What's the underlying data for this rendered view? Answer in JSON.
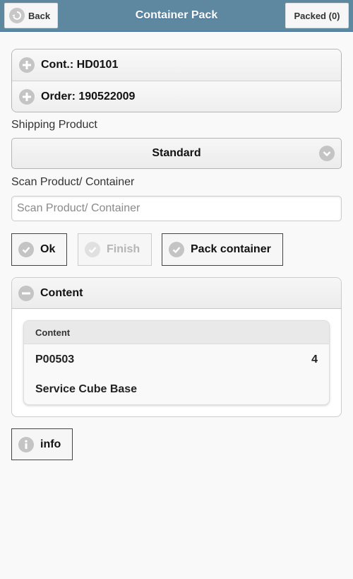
{
  "header": {
    "back_label": "Back",
    "title": "Container Pack",
    "packed_label": "Packed (0)"
  },
  "collapsibles": {
    "container": "Cont.: HD0101",
    "order": "Order: 190522009"
  },
  "shipping": {
    "label": "Shipping Product",
    "selected": "Standard"
  },
  "scan": {
    "label": "Scan Product/ Container",
    "placeholder": "Scan Product/ Container",
    "value": ""
  },
  "buttons": {
    "ok": "Ok",
    "finish": "Finish",
    "pack_container": "Pack container",
    "info": "info"
  },
  "content": {
    "header": "Content",
    "list_header": "Content",
    "items": [
      {
        "code": "P00503",
        "quantity": "4",
        "name": "Service Cube Base"
      }
    ]
  },
  "colors": {
    "header_bg": "#5e87a0",
    "icon_gray": "#c4c4c4"
  }
}
